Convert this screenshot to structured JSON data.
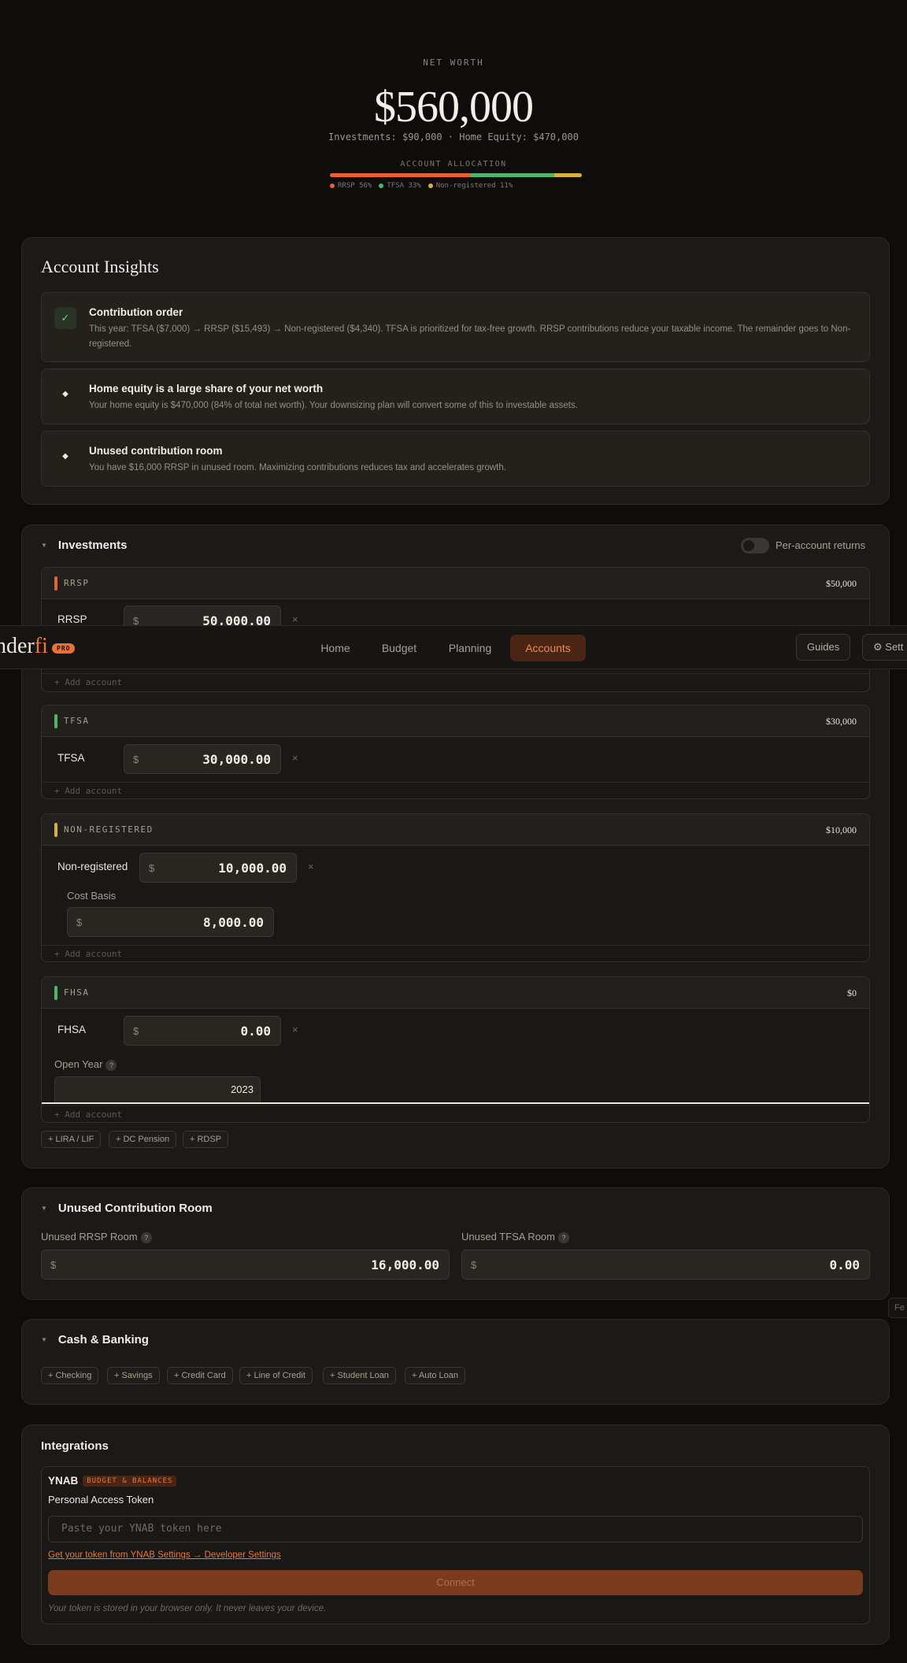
{
  "hero": {
    "net_worth_label": "NET WORTH",
    "net_worth_value": "$560,000",
    "breakdown": "Investments: $90,000 · Home Equity: $470,000",
    "allocation_label": "ACCOUNT ALLOCATION",
    "allocation": [
      {
        "label": "RRSP 56%",
        "percent": 56,
        "color": "#e8622e"
      },
      {
        "label": "TFSA 33%",
        "percent": 33,
        "color": "#4fb56d"
      },
      {
        "label": "Non-registered 11%",
        "percent": 11,
        "color": "#d9b13a"
      }
    ]
  },
  "insights": {
    "title": "Account Insights",
    "items": [
      {
        "icon": "check-icon",
        "title": "Contribution order",
        "text": "This year: TFSA ($7,000) → RRSP ($15,493) → Non-registered ($4,340). TFSA is prioritized for tax-free growth. RRSP contributions reduce your taxable income. The remainder goes to Non-registered."
      },
      {
        "icon": "diamond-icon",
        "title": "Home equity is a large share of your net worth",
        "text": "Your home equity is $470,000 (84% of total net worth). Your downsizing plan will convert some of this to investable assets."
      },
      {
        "icon": "diamond-icon",
        "title": "Unused contribution room",
        "text": "You have $16,000 RRSP in unused room. Maximizing contributions reduces tax and accelerates growth."
      }
    ]
  },
  "nav": {
    "logo_prefix": "nder",
    "logo_suffix": "fi",
    "pro_badge": "PRO",
    "items": [
      "Home",
      "Budget",
      "Planning",
      "Accounts"
    ],
    "active": "Accounts",
    "guides": "Guides",
    "settings": "Sett"
  },
  "investments": {
    "title": "Investments",
    "toggle_label": "Per-account returns",
    "add_account": "+ Add account",
    "accounts": {
      "rrsp": {
        "header": "RRSP",
        "total": "$50,000",
        "color": "#e8622e",
        "row_label": "RRSP",
        "currency": "$",
        "value": "50,000.00"
      },
      "tfsa": {
        "header": "TFSA",
        "total": "$30,000",
        "color": "#4fb56d",
        "row_label": "TFSA",
        "currency": "$",
        "value": "30,000.00"
      },
      "nonreg": {
        "header": "NON-REGISTERED",
        "total": "$10,000",
        "color": "#d9b13a",
        "row_label": "Non-registered",
        "currency": "$",
        "value": "10,000.00",
        "cost_basis_label": "Cost Basis",
        "cost_basis": "8,000.00"
      },
      "fhsa": {
        "header": "FHSA",
        "total": "$0",
        "color": "#4fb56d",
        "row_label": "FHSA",
        "currency": "$",
        "value": "0.00",
        "open_year_label": "Open Year",
        "open_year": "2023"
      }
    },
    "extra_chips": [
      "+ LIRA / LIF",
      "+ DC Pension",
      "+ RDSP"
    ]
  },
  "unused_room": {
    "title": "Unused Contribution Room",
    "rrsp_label": "Unused RRSP Room",
    "rrsp_value": "16,000.00",
    "tfsa_label": "Unused TFSA Room",
    "tfsa_value": "0.00",
    "currency": "$"
  },
  "cash": {
    "title": "Cash & Banking",
    "chips": [
      "+ Checking",
      "+ Savings",
      "+ Credit Card",
      "+ Line of Credit",
      "+ Student Loan",
      "+ Auto Loan"
    ]
  },
  "integrations": {
    "title": "Integrations",
    "ynab_name": "YNAB",
    "ynab_badge": "BUDGET & BALANCES",
    "token_label": "Personal Access Token",
    "token_placeholder": "Paste your YNAB token here",
    "token_link": "Get your token from YNAB Settings → Developer Settings",
    "connect": "Connect",
    "note": "Your token is stored in your browser only. It never leaves your device."
  },
  "side_tab": "Fe"
}
